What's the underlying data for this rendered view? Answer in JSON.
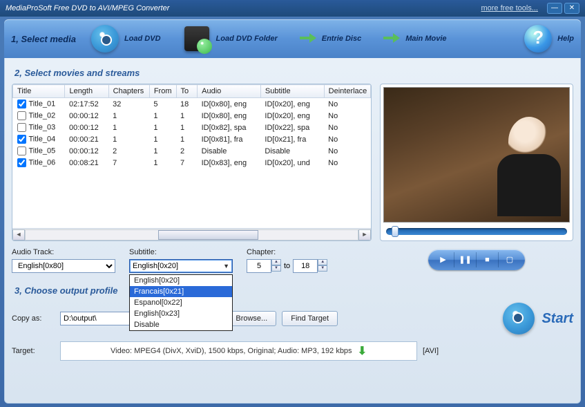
{
  "app_title": "MediaProSoft Free DVD to AVI/MPEG Converter",
  "more_tools": "more free tools...",
  "step1_label": "1, Select media",
  "toolbar": {
    "load_dvd": "Load DVD",
    "load_folder": "Load DVD Folder",
    "entire_disc": "Entrie Disc",
    "main_movie": "Main Movie",
    "help": "Help"
  },
  "step2_label": "2, Select movies and streams",
  "columns": [
    "Title",
    "Length",
    "Chapters",
    "From",
    "To",
    "Audio",
    "Subtitle",
    "Deinterlace"
  ],
  "rows": [
    {
      "chk": true,
      "title": "Title_01",
      "length": "02:17:52",
      "chapters": "32",
      "from": "5",
      "to": "18",
      "audio": "ID[0x80], eng",
      "subtitle": "ID[0x20], eng",
      "deint": "No"
    },
    {
      "chk": false,
      "title": "Title_02",
      "length": "00:00:12",
      "chapters": "1",
      "from": "1",
      "to": "1",
      "audio": "ID[0x80], eng",
      "subtitle": "ID[0x20], eng",
      "deint": "No"
    },
    {
      "chk": false,
      "title": "Title_03",
      "length": "00:00:12",
      "chapters": "1",
      "from": "1",
      "to": "1",
      "audio": "ID[0x82], spa",
      "subtitle": "ID[0x22], spa",
      "deint": "No"
    },
    {
      "chk": true,
      "title": "Title_04",
      "length": "00:00:21",
      "chapters": "1",
      "from": "1",
      "to": "1",
      "audio": "ID[0x81], fra",
      "subtitle": "ID[0x21], fra",
      "deint": "No"
    },
    {
      "chk": false,
      "title": "Title_05",
      "length": "00:00:12",
      "chapters": "2",
      "from": "1",
      "to": "2",
      "audio": "Disable",
      "subtitle": "Disable",
      "deint": "No"
    },
    {
      "chk": true,
      "title": "Title_06",
      "length": "00:08:21",
      "chapters": "7",
      "from": "1",
      "to": "7",
      "audio": "ID[0x83], eng",
      "subtitle": "ID[0x20], und",
      "deint": "No"
    }
  ],
  "labels": {
    "audio_track": "Audio Track:",
    "subtitle": "Subtitle:",
    "chapter": "Chapter:",
    "to": "to",
    "copy_as": "Copy as:",
    "target": "Target:",
    "browse": "Browse...",
    "find_target": "Find Target",
    "start": "Start",
    "avi_tag": "[AVI]"
  },
  "audio_track_value": "English[0x80]",
  "subtitle_value": "English[0x20]",
  "subtitle_options": [
    "English[0x20]",
    "Francais[0x21]",
    "Espanol[0x22]",
    "English[0x23]",
    "Disable"
  ],
  "subtitle_selected_index": 1,
  "chapter_from": "5",
  "chapter_to": "18",
  "step3_label": "3, Choose output profile",
  "output_path": "D:\\output\\",
  "target_desc": "Video: MPEG4 (DivX, XviD), 1500 kbps, Original; Audio: MP3, 192 kbps"
}
